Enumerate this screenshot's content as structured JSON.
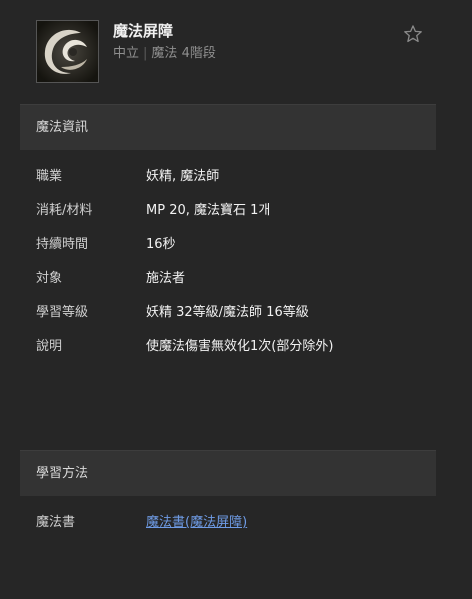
{
  "header": {
    "title": "魔法屏障",
    "alignment": "中立",
    "category": "魔法",
    "tier": "4階段",
    "favorite_icon": "star-outline-icon",
    "skill_icon": "swirl-skill-icon"
  },
  "info_section": {
    "heading": "魔法資訊",
    "rows": [
      {
        "label": "職業",
        "value": "妖精, 魔法師"
      },
      {
        "label": "消耗/材料",
        "value": "MP 20, 魔法寶石 1개"
      },
      {
        "label": "持續時間",
        "value": "16秒"
      },
      {
        "label": "対象",
        "value": "施法者"
      },
      {
        "label": "學習等級",
        "value": "妖精 32等級/魔法師 16等級"
      },
      {
        "label": "說明",
        "value": "使魔法傷害無效化1次(部分除外)"
      }
    ]
  },
  "learn_section": {
    "heading": "學習方法",
    "rows": [
      {
        "label": "魔法書",
        "value": "魔法書(魔法屏障)"
      }
    ]
  },
  "colors": {
    "background": "#262626",
    "section_header": "#333333",
    "link": "#6f9ce6",
    "muted": "#8f8f8f"
  }
}
